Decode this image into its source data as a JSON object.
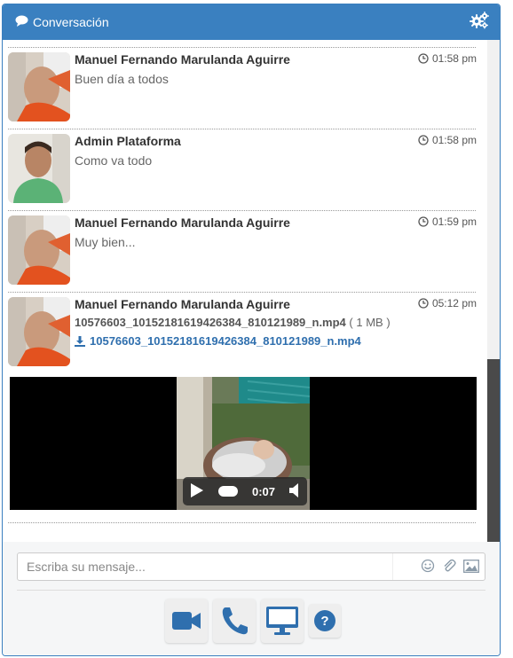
{
  "header": {
    "title": "Conversación",
    "icon": "comment-icon",
    "settings_icon": "gears-icon"
  },
  "messages": [
    {
      "author": "Manuel Fernando Marulanda Aguirre",
      "time": "01:58 pm",
      "text": "Buen día a todos"
    },
    {
      "author": "Admin Plataforma",
      "time": "01:58 pm",
      "text": "Como va todo"
    },
    {
      "author": "Manuel Fernando Marulanda Aguirre",
      "time": "01:59 pm",
      "text": "Muy bien..."
    },
    {
      "author": "Manuel Fernando Marulanda Aguirre",
      "time": "05:12 pm",
      "file_name": "10576603_10152181619426384_810121989_n.mp4",
      "file_size": "( 1 MB )",
      "link": "10576603_10152181619426384_810121989_n.mp4"
    }
  ],
  "video": {
    "time": "0:07"
  },
  "composer": {
    "placeholder": "Escriba su mensaje..."
  },
  "actions": [
    "video-camera-icon",
    "phone-icon",
    "monitor-icon",
    "help-icon"
  ],
  "colors": {
    "header": "#3a80c0",
    "link": "#2f6fae",
    "icon_blue": "#2f6fae"
  }
}
